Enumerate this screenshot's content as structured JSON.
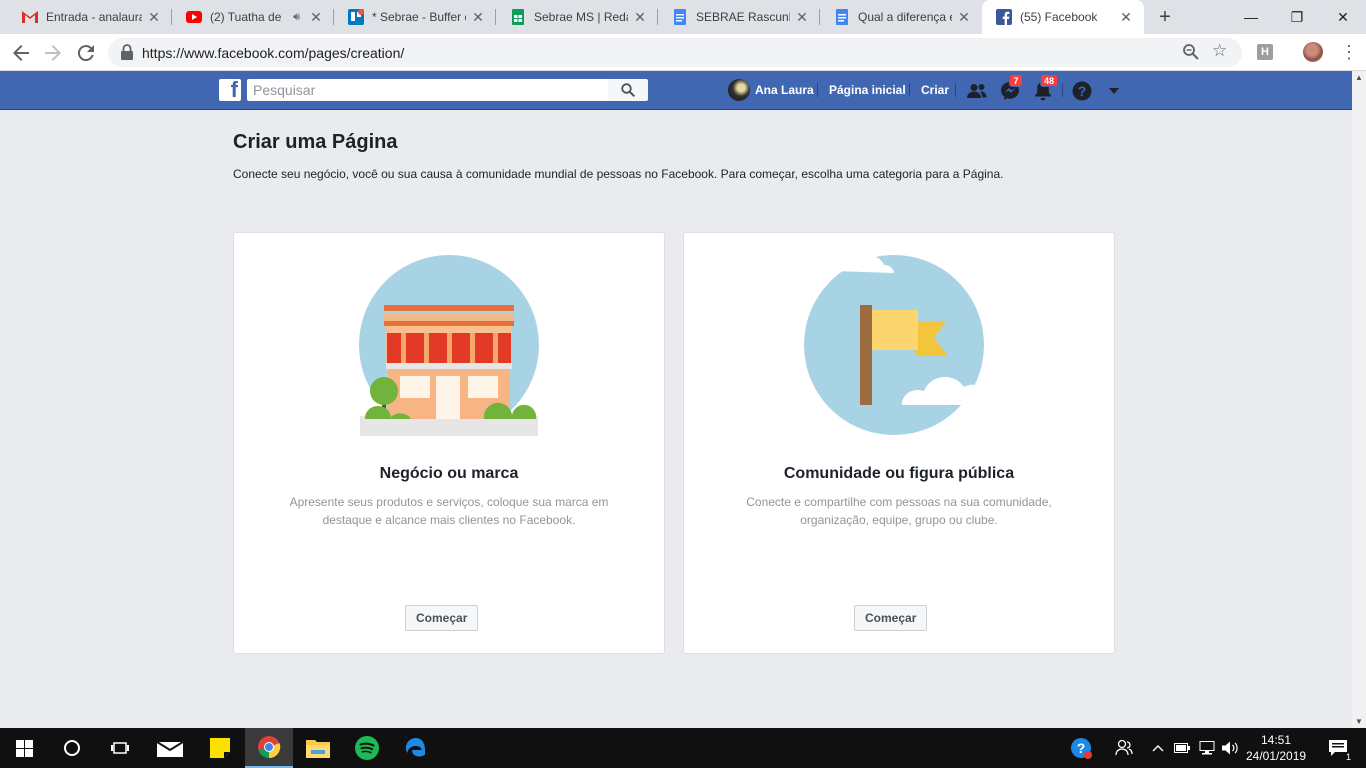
{
  "browser": {
    "tabs": [
      {
        "title": "Entrada - analaura",
        "icon": "gmail-icon"
      },
      {
        "title": "(2) Tuatha de",
        "icon": "youtube-icon",
        "audio": true
      },
      {
        "title": "* Sebrae - Buffer c",
        "icon": "trello-icon"
      },
      {
        "title": "Sebrae MS | Redaç",
        "icon": "sheets-icon"
      },
      {
        "title": "SEBRAE Rascunhos",
        "icon": "docs-icon"
      },
      {
        "title": "Qual a diferença e",
        "icon": "docs-icon"
      },
      {
        "title": "(55) Facebook",
        "icon": "facebook-icon",
        "active": true
      }
    ],
    "url": "https://www.facebook.com/pages/creation/",
    "extension_label": "H"
  },
  "facebook": {
    "search_placeholder": "Pesquisar",
    "user_name": "Ana Laura",
    "nav_home": "Página inicial",
    "nav_create": "Criar",
    "messages_badge": "7",
    "notifications_badge": "48",
    "brand_color": "#4267b2"
  },
  "page": {
    "title": "Criar uma Página",
    "subtitle": "Conecte seu negócio, você ou sua causa à comunidade mundial de pessoas no Facebook. Para começar, escolha uma categoria para a Página.",
    "cards": [
      {
        "title": "Negócio ou marca",
        "description": "Apresente seus produtos e serviços, coloque sua marca em destaque e alcance mais clientes no Facebook.",
        "button": "Começar"
      },
      {
        "title": "Comunidade ou figura pública",
        "description": "Conecte e compartilhe com pessoas na sua comunidade, organização, equipe, grupo ou clube.",
        "button": "Começar"
      }
    ]
  },
  "taskbar": {
    "time": "14:51",
    "date": "24/01/2019",
    "notification_count": "1"
  }
}
